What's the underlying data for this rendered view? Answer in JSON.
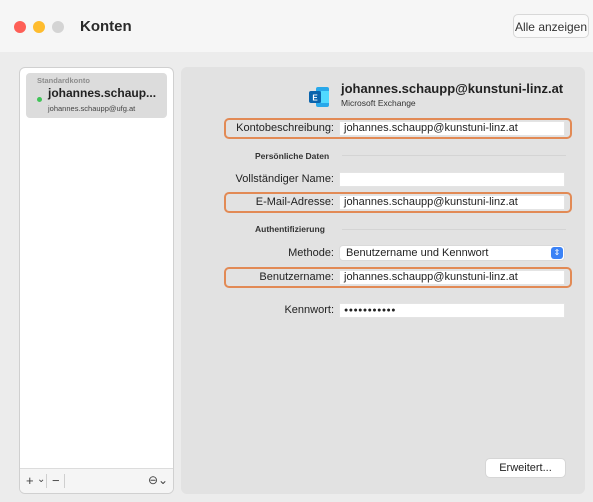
{
  "window": {
    "title": "Konten",
    "show_all": "Alle anzeigen"
  },
  "sidebar": {
    "account": {
      "header": "Standardkonto",
      "name": "johannes.schaup...",
      "email": "johannes.schaupp@ufg.at"
    },
    "add": "+",
    "add_menu": "⌄",
    "remove": "−",
    "action_menu": "⊖⌄"
  },
  "account": {
    "email": "johannes.schaupp@kunstuni-linz.at",
    "type": "Microsoft Exchange",
    "icon": "microsoft-exchange-icon"
  },
  "form": {
    "description_label": "Kontobeschreibung:",
    "description_value": "johannes.schaupp@kunstuni-linz.at",
    "personal_header": "Persönliche Daten",
    "fullname_label": "Vollständiger Name:",
    "fullname_value": "",
    "email_label": "E-Mail-Adresse:",
    "email_value": "johannes.schaupp@kunstuni-linz.at",
    "auth_header": "Authentifizierung",
    "method_label": "Methode:",
    "method_value": "Benutzername und Kennwort",
    "username_label": "Benutzername:",
    "username_value": "johannes.schaupp@kunstuni-linz.at",
    "password_label": "Kennwort:",
    "password_value": "●●●●●●●●●●●"
  },
  "buttons": {
    "advanced": "Erweitert..."
  },
  "colors": {
    "highlight": "#e28a55",
    "status_online": "#3fc457",
    "exchange_blue": "#1490df"
  }
}
